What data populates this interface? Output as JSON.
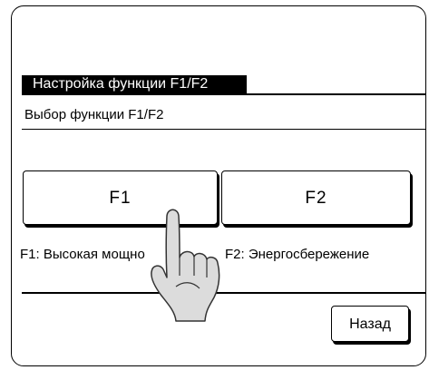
{
  "screen": {
    "title": "Настройка функции F1/F2",
    "subtitle": "Выбор функции F1/F2"
  },
  "functions": {
    "f1_label": "F1",
    "f2_label": "F2",
    "f1_description": "F1: Высокая мощно",
    "f2_description": "F2: Энергосбережение"
  },
  "footer": {
    "back_label": "Назад"
  },
  "icons": {
    "hand": "pointing-hand-icon"
  }
}
